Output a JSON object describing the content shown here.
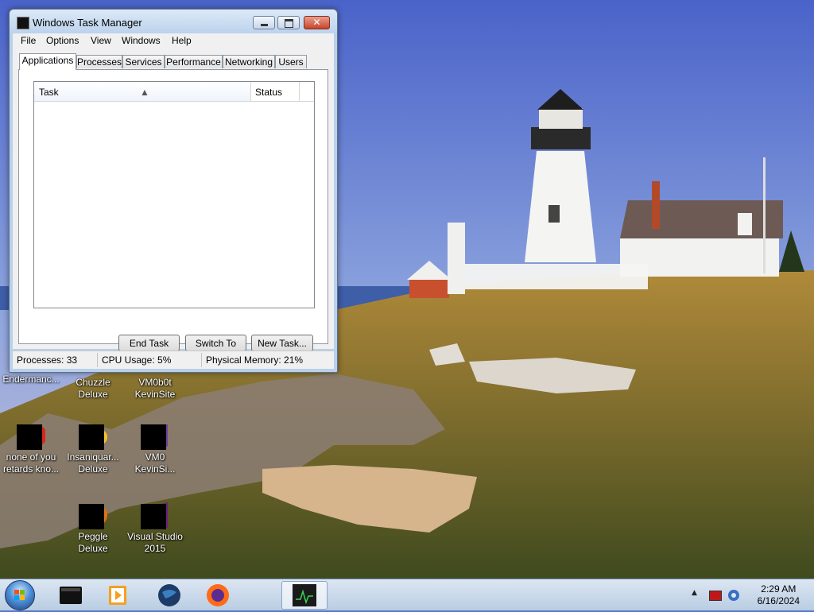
{
  "window": {
    "title": "Windows Task Manager",
    "close_glyph": "✕",
    "menu": [
      "File",
      "Options",
      "View",
      "Windows",
      "Help"
    ],
    "tabs": [
      "Applications",
      "Processes",
      "Services",
      "Performance",
      "Networking",
      "Users"
    ],
    "active_tab": "Applications",
    "list": {
      "columns": [
        "Task",
        "Status"
      ],
      "sort_indicator": "▲",
      "rows": []
    },
    "buttons": {
      "end_task": "End Task",
      "switch_to": "Switch To",
      "new_task": "New Task..."
    },
    "status": {
      "processes": "Processes: 33",
      "cpu": "CPU Usage: 5%",
      "memory": "Physical Memory: 21%"
    }
  },
  "desktop_icons": [
    {
      "label": "Endermanc...",
      "icon": "app-icon"
    },
    {
      "label": "Chuzzle Deluxe",
      "icon": "chuzzle-icon"
    },
    {
      "label": "VM0b0t KevinSite",
      "icon": "vm-icon"
    },
    {
      "label": "none of you retards kno...",
      "icon": "opera-icon"
    },
    {
      "label": "Insaniquar... Deluxe",
      "icon": "insaniquarium-icon"
    },
    {
      "label": "VM0 KevinSi...",
      "icon": "vm-icon"
    },
    {
      "label": "Peggle Deluxe",
      "icon": "peggle-icon"
    },
    {
      "label": "Visual Studio 2015",
      "icon": "visual-studio-icon"
    }
  ],
  "taskbar": {
    "pinned": [
      "start-orb",
      "terminal-icon",
      "media-player-icon",
      "globe-icon",
      "firefox-icon",
      "task-manager-icon"
    ],
    "clock_time": "2:29 AM",
    "clock_date": "6/16/2024",
    "tray_arrow": "▲"
  },
  "colors": {
    "window_frame": "#b9d1ea",
    "close_button": "#c8432a",
    "taskbar": "#c8d8ea"
  }
}
